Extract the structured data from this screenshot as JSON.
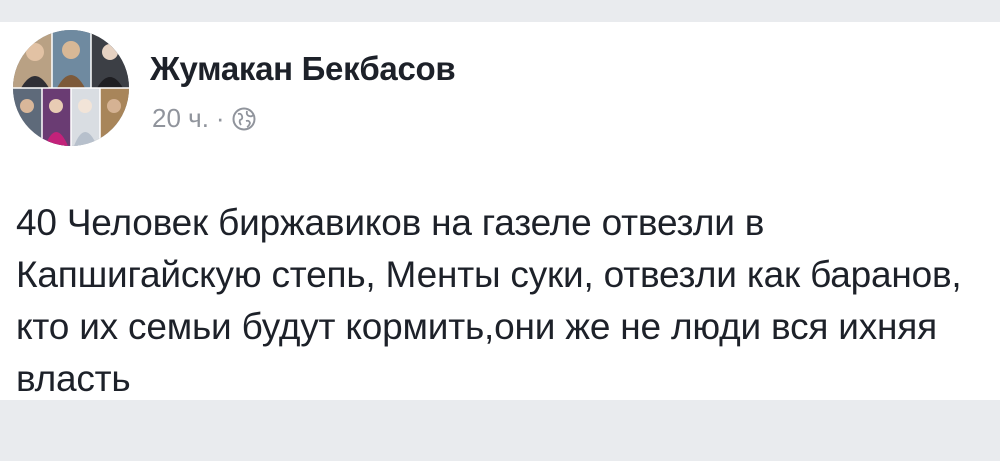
{
  "post": {
    "author": {
      "name": "Жумакан Бекбасов",
      "avatar_icon": "avatar-photo-collage"
    },
    "meta": {
      "time": "20 ч.",
      "separator": "·",
      "privacy_icon": "globe-icon"
    },
    "body": "40 Человек биржавиков на газеле отвезли в Капшигайскую степь, Менты суки, отвезли как баранов, кто их семьи будут кормить,они же не люди вся ихняя власть"
  },
  "colors": {
    "background": "#e9ebee",
    "card": "#ffffff",
    "text": "#1d2129",
    "secondary_text": "#90949c"
  }
}
